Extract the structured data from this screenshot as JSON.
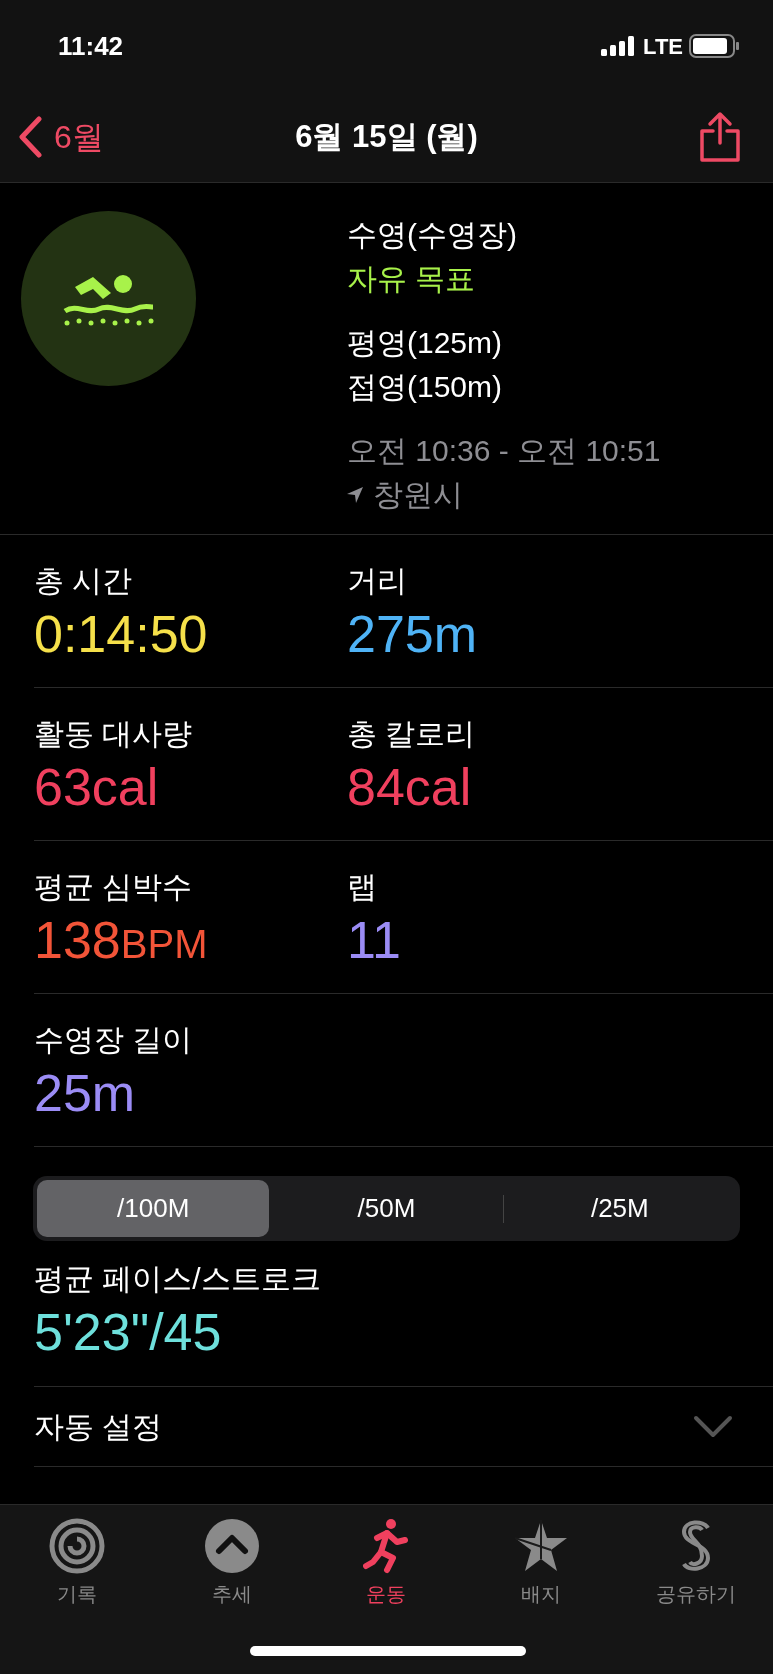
{
  "status_bar": {
    "time": "11:42",
    "network": "LTE"
  },
  "nav": {
    "back": "6월",
    "title": "6월 15일 (월)"
  },
  "workout": {
    "type": "수영(수영장)",
    "goal": "자유 목표",
    "strokes": [
      "평영(125m)",
      "접영(150m)"
    ],
    "time_range": "오전 10:36 - 오전 10:51",
    "location": "창원시"
  },
  "stats": [
    [
      {
        "label": "총 시간",
        "value": "0:14:50",
        "color": "#f5e04a"
      },
      {
        "label": "거리",
        "value": "275m",
        "color": "#4fb3f6"
      }
    ],
    [
      {
        "label": "활동 대사량",
        "value": "63cal",
        "color": "#f0405e"
      },
      {
        "label": "총 칼로리",
        "value": "84cal",
        "color": "#f0405e"
      }
    ],
    [
      {
        "label": "평균 심박수",
        "value": "138",
        "unit": "BPM",
        "color": "#f25438"
      },
      {
        "label": "랩",
        "value": "11",
        "color": "#9b8cf5"
      }
    ],
    [
      {
        "label": "수영장 길이",
        "value": "25m",
        "color": "#9b8cf5"
      }
    ]
  ],
  "segments": [
    {
      "label": "/100M",
      "selected": true
    },
    {
      "label": "/50M",
      "selected": false
    },
    {
      "label": "/25M",
      "selected": false
    }
  ],
  "pace": {
    "label": "평균 페이스/스트로크",
    "value": "5'23\"/45"
  },
  "auto_set": {
    "label": "자동 설정",
    "expanded": false
  },
  "tabs": [
    {
      "label": "기록",
      "kind": "rings",
      "selected": false
    },
    {
      "label": "추세",
      "kind": "trend",
      "selected": false
    },
    {
      "label": "운동",
      "kind": "workout",
      "selected": true
    },
    {
      "label": "배지",
      "kind": "badge",
      "selected": false
    },
    {
      "label": "공유하기",
      "kind": "share",
      "selected": false
    }
  ]
}
